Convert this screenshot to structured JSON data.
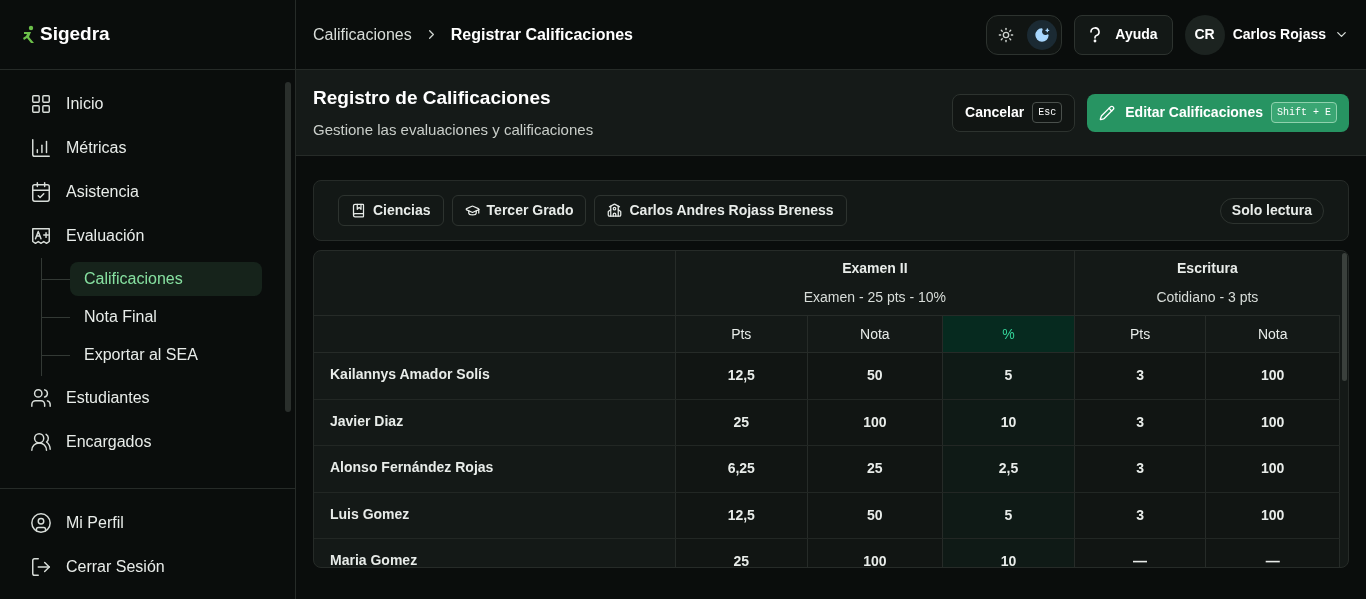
{
  "sidebar": {
    "logo": "Sigedra",
    "items": [
      {
        "kind": "grid",
        "label": "Inicio",
        "selected": false
      },
      {
        "kind": "chart",
        "label": "Métricas",
        "selected": false
      },
      {
        "kind": "calendar",
        "label": "Asistencia",
        "selected": false
      },
      {
        "kind": "grade",
        "label": "Evaluación",
        "selected": false,
        "children": [
          {
            "label": "Calificaciones",
            "selected": true
          },
          {
            "label": "Nota Final",
            "selected": false
          },
          {
            "label": "Exportar al SEA",
            "selected": false
          }
        ]
      },
      {
        "kind": "users",
        "label": "Estudiantes",
        "selected": false
      },
      {
        "kind": "group",
        "label": "Encargados",
        "selected": false
      }
    ],
    "bottom_items": [
      {
        "kind": "profile",
        "label": "Mi Perfil"
      },
      {
        "kind": "logout",
        "label": "Cerrar Sesión"
      }
    ]
  },
  "topbar": {
    "breadcrumb": [
      "Calificaciones",
      "Registrar Calificaciones"
    ],
    "theme_toggle": [
      {
        "kind": "light",
        "selected": false
      },
      {
        "kind": "dark",
        "selected": true
      }
    ],
    "help": "Ayuda",
    "user": {
      "initials": "CR",
      "name": "Carlos Rojass"
    }
  },
  "page_header": {
    "title": "Registro de Calificaciones",
    "subtitle": "Gestione las evaluaciones y calificaciones",
    "buttons": [
      {
        "kind": "secondary",
        "label": "Cancelar",
        "shortcut": "Esc"
      },
      {
        "kind": "primary",
        "label": "Editar Calificaciones",
        "shortcut": "Shift + E"
      }
    ]
  },
  "filters": {
    "chips": [
      {
        "kind": "book",
        "label": "Ciencias"
      },
      {
        "kind": "cap",
        "label": "Tercer Grado"
      },
      {
        "kind": "school",
        "label": "Carlos Andres Rojass Breness"
      }
    ],
    "badge": "Solo lectura"
  },
  "table": {
    "groups": [
      {
        "title": "Examen II",
        "subtitle": "Examen - 25 pts - 10%",
        "columns": [
          {
            "label": "Pts",
            "highlighted": false
          },
          {
            "label": "Nota",
            "highlighted": false
          },
          {
            "label": "%",
            "highlighted": true
          }
        ]
      },
      {
        "title": "Escritura",
        "subtitle": "Cotidiano - 3 pts",
        "columns": [
          {
            "label": "Pts",
            "highlighted": false
          },
          {
            "label": "Nota",
            "highlighted": false
          }
        ]
      }
    ],
    "rows": [
      {
        "name": "Kailannys Amador Solís",
        "cells": [
          "12,5",
          "50",
          "5",
          "3",
          "100"
        ]
      },
      {
        "name": "Javier Diaz",
        "cells": [
          "25",
          "100",
          "10",
          "3",
          "100"
        ]
      },
      {
        "name": "Alonso Fernández Rojas",
        "cells": [
          "6,25",
          "25",
          "2,5",
          "3",
          "100"
        ]
      },
      {
        "name": "Luis Gomez",
        "cells": [
          "12,5",
          "50",
          "5",
          "3",
          "100"
        ]
      },
      {
        "name": "Maria Gomez",
        "cells": [
          "25",
          "100",
          "10",
          "—",
          "—"
        ]
      }
    ]
  }
}
